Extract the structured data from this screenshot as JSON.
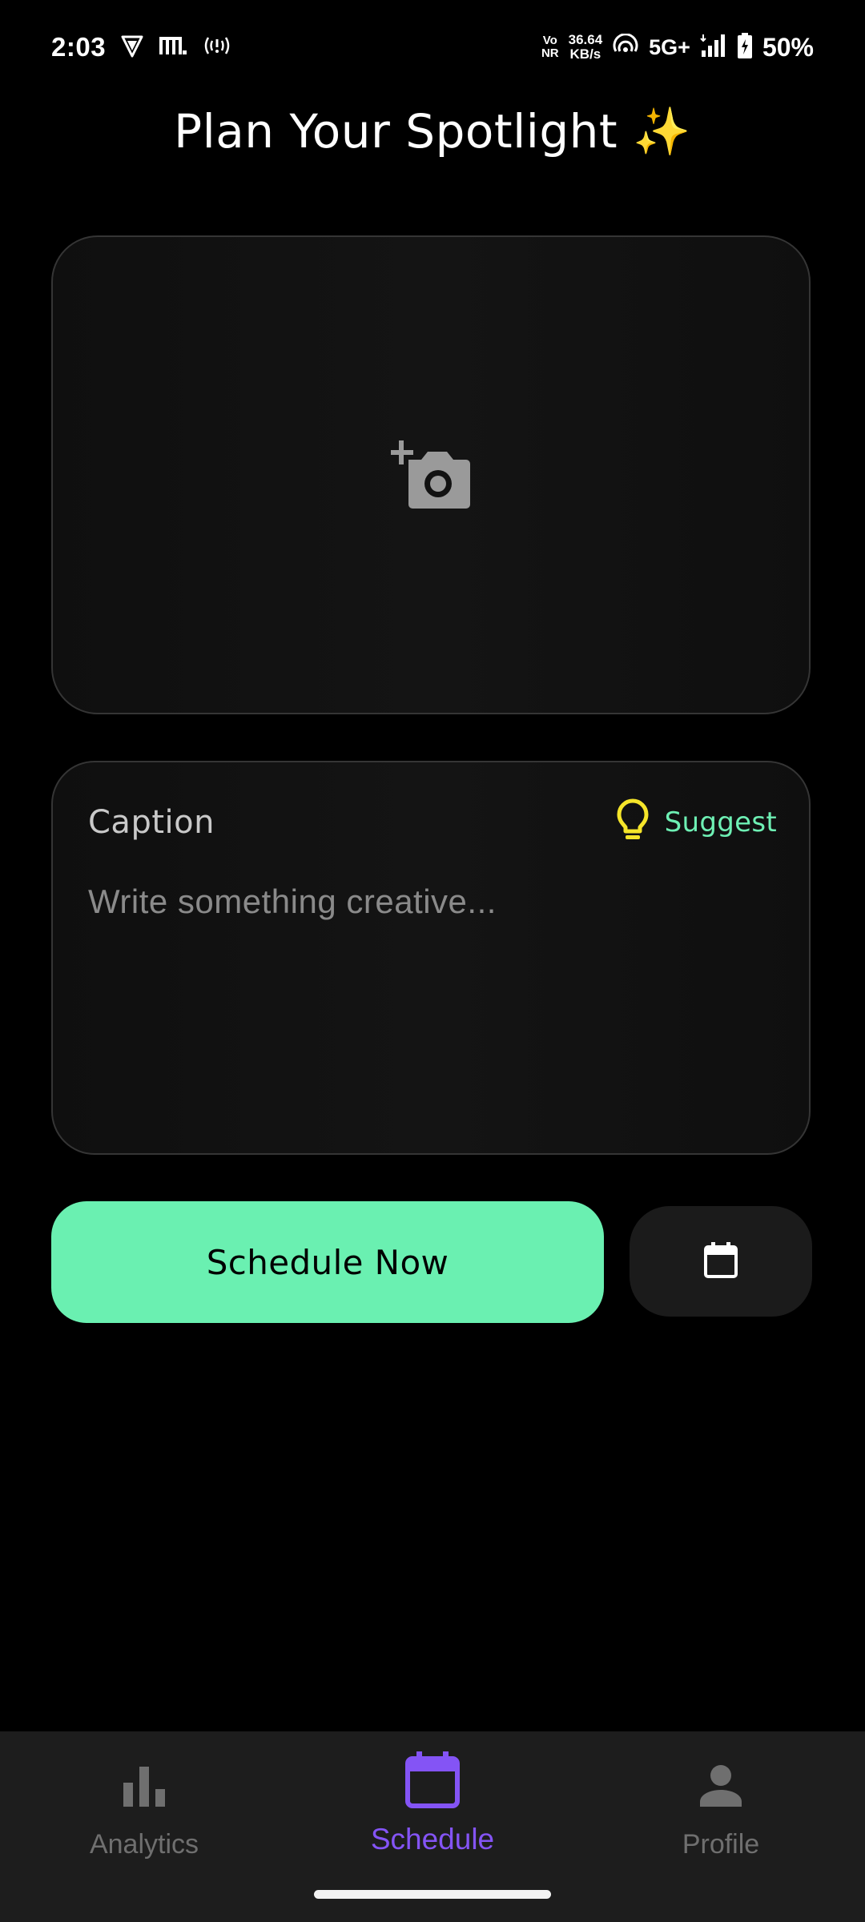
{
  "status_bar": {
    "time": "2:03",
    "volte_top": "Vo",
    "volte_bottom": "NR",
    "net_speed_value": "36.64",
    "net_speed_unit": "KB/s",
    "network_type": "5G+",
    "battery": "50%",
    "icons": [
      "vpn-shield-icon",
      "app-m-icon",
      "hotspot-icon",
      "wifi-calling-icon",
      "signal-icon",
      "battery-charging-icon"
    ]
  },
  "page": {
    "title": "Plan Your Spotlight ✨"
  },
  "photo_picker": {
    "icon": "add-photo-camera-icon"
  },
  "caption": {
    "label": "Caption",
    "suggest_label": "Suggest",
    "suggest_icon": "lightbulb-icon",
    "placeholder": "Write something creative...",
    "value": ""
  },
  "actions": {
    "schedule_now_label": "Schedule Now",
    "calendar_icon": "calendar-icon"
  },
  "bottom_nav": {
    "items": [
      {
        "label": "Analytics",
        "icon": "bar-chart-icon",
        "active": false
      },
      {
        "label": "Schedule",
        "icon": "calendar-icon",
        "active": true
      },
      {
        "label": "Profile",
        "icon": "person-icon",
        "active": false
      }
    ]
  },
  "colors": {
    "accent_green": "#6af0b1",
    "suggest_text": "#6ef0b4",
    "bulb_yellow": "#f5e52a",
    "active_nav": "#8454f5",
    "inactive_nav": "#6f6f6f",
    "background": "#000000"
  }
}
